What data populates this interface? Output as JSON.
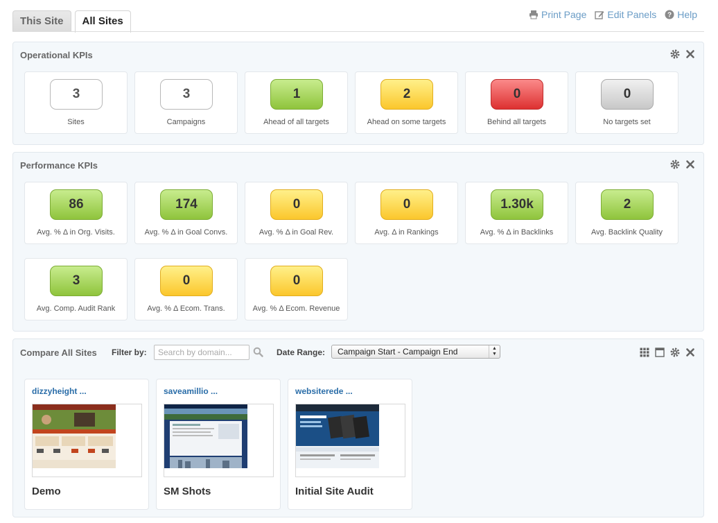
{
  "tabs": [
    {
      "label": "This Site",
      "active": false
    },
    {
      "label": "All Sites",
      "active": true
    }
  ],
  "top_links": {
    "print": "Print Page",
    "edit": "Edit Panels",
    "help": "Help"
  },
  "operational": {
    "title": "Operational KPIs",
    "cards": [
      {
        "value": "3",
        "label": "Sites",
        "color": "white"
      },
      {
        "value": "3",
        "label": "Campaigns",
        "color": "white"
      },
      {
        "value": "1",
        "label": "Ahead of all targets",
        "color": "green"
      },
      {
        "value": "2",
        "label": "Ahead on some targets",
        "color": "yellow"
      },
      {
        "value": "0",
        "label": "Behind all targets",
        "color": "red"
      },
      {
        "value": "0",
        "label": "No targets set",
        "color": "grey"
      }
    ]
  },
  "performance": {
    "title": "Performance KPIs",
    "cards": [
      {
        "value": "86",
        "label": "Avg. % Δ in Org. Visits.",
        "color": "green"
      },
      {
        "value": "174",
        "label": "Avg. % Δ in Goal Convs.",
        "color": "green"
      },
      {
        "value": "0",
        "label": "Avg. % Δ in Goal Rev.",
        "color": "yellow"
      },
      {
        "value": "0",
        "label": "Avg. Δ in Rankings",
        "color": "yellow"
      },
      {
        "value": "1.30k",
        "label": "Avg. % Δ in Backlinks",
        "color": "green"
      },
      {
        "value": "2",
        "label": "Avg. Backlink Quality",
        "color": "green"
      },
      {
        "value": "3",
        "label": "Avg. Comp. Audit Rank",
        "color": "green"
      },
      {
        "value": "0",
        "label": "Avg. % Δ Ecom. Trans.",
        "color": "yellow"
      },
      {
        "value": "0",
        "label": "Avg. % Δ Ecom. Revenue",
        "color": "yellow"
      }
    ]
  },
  "compare": {
    "title": "Compare All Sites",
    "filter_label": "Filter by:",
    "search_placeholder": "Search by domain...",
    "date_label": "Date Range:",
    "date_value": "Campaign Start - Campaign End",
    "sites": [
      {
        "domain": "dizzyheight ...",
        "name": "Demo"
      },
      {
        "domain": "saveamillio ...",
        "name": "SM Shots"
      },
      {
        "domain": "websiterede ...",
        "name": "Initial Site Audit"
      }
    ]
  },
  "colors": {
    "link": "#6a9cc6",
    "domain_link": "#2a6da8",
    "panel_bg": "#f4f8fb",
    "green": "#8fc43c",
    "yellow": "#fbc72c",
    "red": "#dd3131"
  }
}
